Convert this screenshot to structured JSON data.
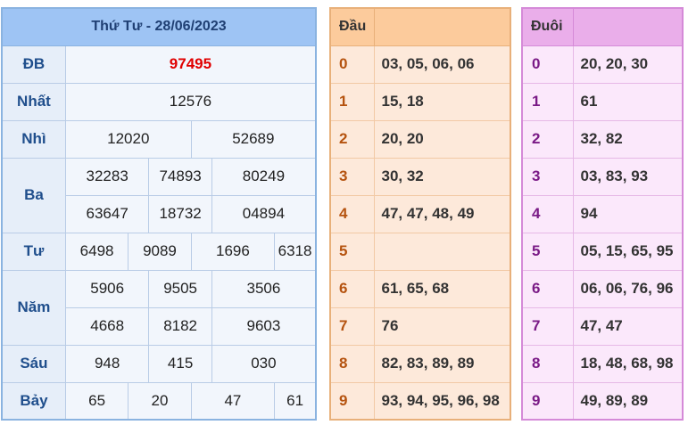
{
  "main": {
    "title": "Thứ Tư - 28/06/2023",
    "prizes": {
      "db": {
        "label": "ĐB",
        "values": [
          "97495"
        ]
      },
      "nhat": {
        "label": "Nhất",
        "values": [
          "12576"
        ]
      },
      "nhi": {
        "label": "Nhì",
        "values": [
          "12020",
          "52689"
        ]
      },
      "ba": {
        "label": "Ba",
        "values": [
          "32283",
          "74893",
          "80249",
          "63647",
          "18732",
          "04894"
        ]
      },
      "tu": {
        "label": "Tư",
        "values": [
          "6498",
          "9089",
          "1696",
          "6318"
        ]
      },
      "nam": {
        "label": "Năm",
        "values": [
          "5906",
          "9505",
          "3506",
          "4668",
          "8182",
          "9603"
        ]
      },
      "sau": {
        "label": "Sáu",
        "values": [
          "948",
          "415",
          "030"
        ]
      },
      "bay": {
        "label": "Bảy",
        "values": [
          "65",
          "20",
          "47",
          "61"
        ]
      }
    }
  },
  "dau": {
    "header": "Đầu",
    "rows": [
      {
        "digit": "0",
        "values": "03, 05, 06, 06"
      },
      {
        "digit": "1",
        "values": "15, 18"
      },
      {
        "digit": "2",
        "values": "20, 20"
      },
      {
        "digit": "3",
        "values": "30, 32"
      },
      {
        "digit": "4",
        "values": "47, 47, 48, 49"
      },
      {
        "digit": "5",
        "values": ""
      },
      {
        "digit": "6",
        "values": "61, 65, 68"
      },
      {
        "digit": "7",
        "values": "76"
      },
      {
        "digit": "8",
        "values": "82, 83, 89, 89"
      },
      {
        "digit": "9",
        "values": "93, 94, 95, 96, 98"
      }
    ]
  },
  "duoi": {
    "header": "Đuôi",
    "rows": [
      {
        "digit": "0",
        "values": "20, 20, 30"
      },
      {
        "digit": "1",
        "values": "61"
      },
      {
        "digit": "2",
        "values": "32, 82"
      },
      {
        "digit": "3",
        "values": "03, 83, 93"
      },
      {
        "digit": "4",
        "values": "94"
      },
      {
        "digit": "5",
        "values": "05, 15, 65, 95"
      },
      {
        "digit": "6",
        "values": "06, 06, 76, 96"
      },
      {
        "digit": "7",
        "values": "47, 47"
      },
      {
        "digit": "8",
        "values": "18, 48, 68, 98"
      },
      {
        "digit": "9",
        "values": "49, 89, 89"
      }
    ]
  },
  "colors": {
    "special_prize": "#e00000",
    "main_header": "#9ec4f4",
    "dau_header": "#fccb9c",
    "duoi_header": "#eaaeea"
  }
}
